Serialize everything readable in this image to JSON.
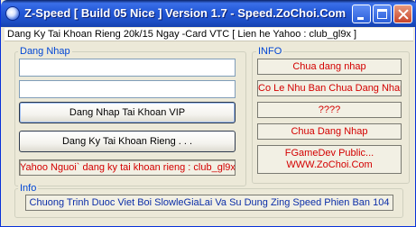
{
  "window": {
    "title": "Z-Speed [ Build 05 Nice ] Version 1.7 - Speed.ZoChoi.Com"
  },
  "notice": {
    "text": "Dang Ky Tai Khoan Rieng 20k/15 Ngay -Card VTC [ Lien he  Yahoo : club_gl9x ]"
  },
  "login_group": {
    "legend": "Dang Nhap",
    "username_value": "",
    "password_value": "",
    "login_vip_button": "Dang Nhap Tai Khoan VIP",
    "register_button": "Dang Ky Tai Khoan Rieng . . .",
    "contact_text": "Yahoo Nguoi` dang ky tai khoan rieng : club_gl9x"
  },
  "info_group": {
    "legend": "INFO",
    "status_1": "Chua dang nhap",
    "status_2": "Co Le Nhu Ban Chua Dang Nhap",
    "status_3": "????",
    "status_4": "Chua Dang Nhap",
    "credit_line_1": "FGameDev Public...",
    "credit_line_2": "WWW.ZoChoi.Com"
  },
  "bottom_group": {
    "legend": "Info",
    "text": "Chuong Trinh Duoc Viet Boi SlowleGiaLai Va Su Dung Zing Speed Phien Ban 104"
  },
  "colors": {
    "titlebar": "#2358d8",
    "legend_text": "#0046d5",
    "status_text": "#d30000",
    "bottom_text": "#0c2ea8",
    "window_bg": "#ece9d8"
  }
}
